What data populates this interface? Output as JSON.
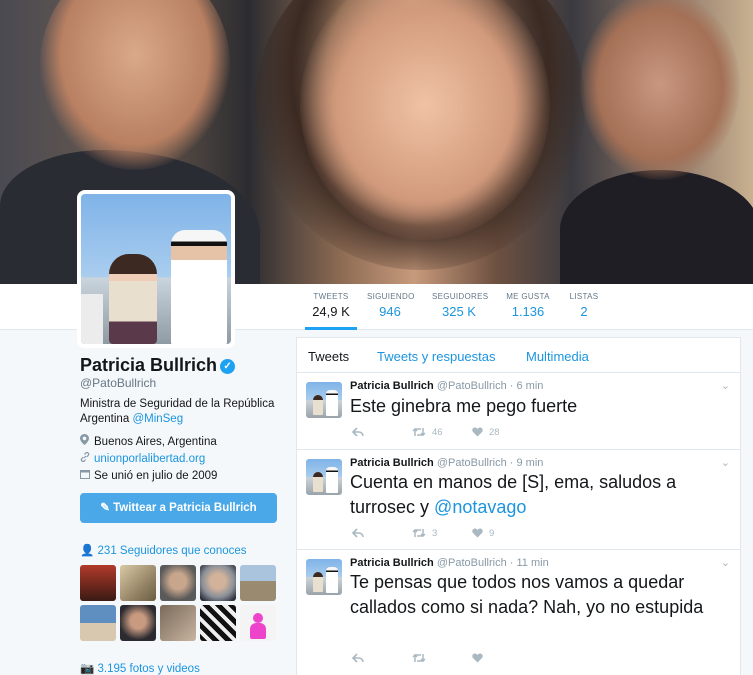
{
  "profile": {
    "name": "Patricia Bullrich",
    "handle": "@PatoBullrich",
    "bio_text": "Ministra de Seguridad de la República Argentina",
    "bio_link": "@MinSeg",
    "location": "Buenos Aires, Argentina",
    "website": "unionporlalibertad.org",
    "joined": "Se unió en julio de 2009",
    "tweet_to_label": "Twittear a Patricia Bullrich",
    "followers_you_know": "231 Seguidores que conoces",
    "photos_videos": "3.195 fotos y videos"
  },
  "stats": [
    {
      "label": "TWEETS",
      "value": "24,9 K"
    },
    {
      "label": "SIGUIENDO",
      "value": "946"
    },
    {
      "label": "SEGUIDORES",
      "value": "325 K"
    },
    {
      "label": "ME GUSTA",
      "value": "1.136"
    },
    {
      "label": "LISTAS",
      "value": "2"
    }
  ],
  "tabs": [
    "Tweets",
    "Tweets y respuestas",
    "Multimedia"
  ],
  "tweets": [
    {
      "author": "Patricia Bullrich",
      "handle": "@PatoBullrich",
      "time": "· 6 min",
      "text": "Este ginebra me pego fuerte",
      "retweets": "46",
      "likes": "28"
    },
    {
      "author": "Patricia Bullrich",
      "handle": "@PatoBullrich",
      "time": "· 9 min",
      "text": "Cuenta en manos de [S], ema, saludos a turrosec y",
      "mention": "@notavago",
      "retweets": "3",
      "likes": "9"
    },
    {
      "author": "Patricia Bullrich",
      "handle": "@PatoBullrich",
      "time": "· 11 min",
      "text": "Te pensas que todos nos vamos a quedar callados como si nada? Nah, yo no estupida",
      "retweets": "",
      "likes": ""
    }
  ],
  "colors": {
    "accent": "#1da1f2",
    "link": "#1b95e0",
    "button": "#4aa8e8",
    "background": "#f5f8fa"
  },
  "icons": {
    "verified": "verified-badge-icon",
    "location": "map-pin-icon",
    "link": "link-icon",
    "calendar": "calendar-icon",
    "people": "people-icon",
    "camera": "camera-icon",
    "reply": "reply-icon",
    "retweet": "retweet-icon",
    "like": "heart-icon",
    "more": "chevron-down-icon"
  }
}
